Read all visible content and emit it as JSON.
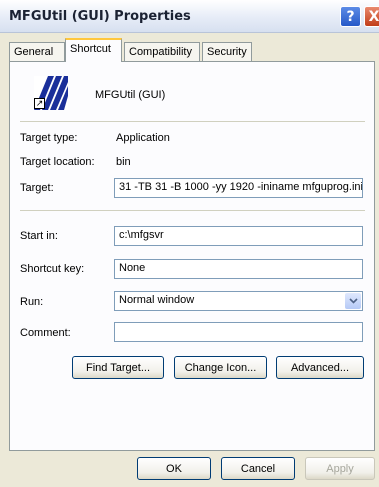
{
  "window": {
    "title": "MFGUtil (GUI) Properties",
    "help_label": "?",
    "close_label": "X"
  },
  "tabs": [
    {
      "label": "General"
    },
    {
      "label": "Shortcut"
    },
    {
      "label": "Compatibility"
    },
    {
      "label": "Security"
    }
  ],
  "shortcut": {
    "name": "MFGUtil (GUI)",
    "icon": "app-shortcut-icon",
    "target_type_label": "Target type:",
    "target_type_value": "Application",
    "target_location_label": "Target location:",
    "target_location_value": "bin",
    "target_label": "Target:",
    "target_value": "31 -TB 31 -B 1000 -yy 1920 -ininame mfguprog.ini",
    "start_in_label": "Start in:",
    "start_in_value": "c:\\mfgsvr",
    "shortcut_key_label": "Shortcut key:",
    "shortcut_key_value": "None",
    "run_label": "Run:",
    "run_value": "Normal window",
    "comment_label": "Comment:",
    "comment_value": ""
  },
  "buttons": {
    "find_target": "Find Target...",
    "change_icon": "Change Icon...",
    "advanced": "Advanced...",
    "ok": "OK",
    "cancel": "Cancel",
    "apply": "Apply"
  },
  "colors": {
    "active_tab_accent": "#ffc73c",
    "field_border": "#7f9db9",
    "close_button": "#c13d19"
  }
}
